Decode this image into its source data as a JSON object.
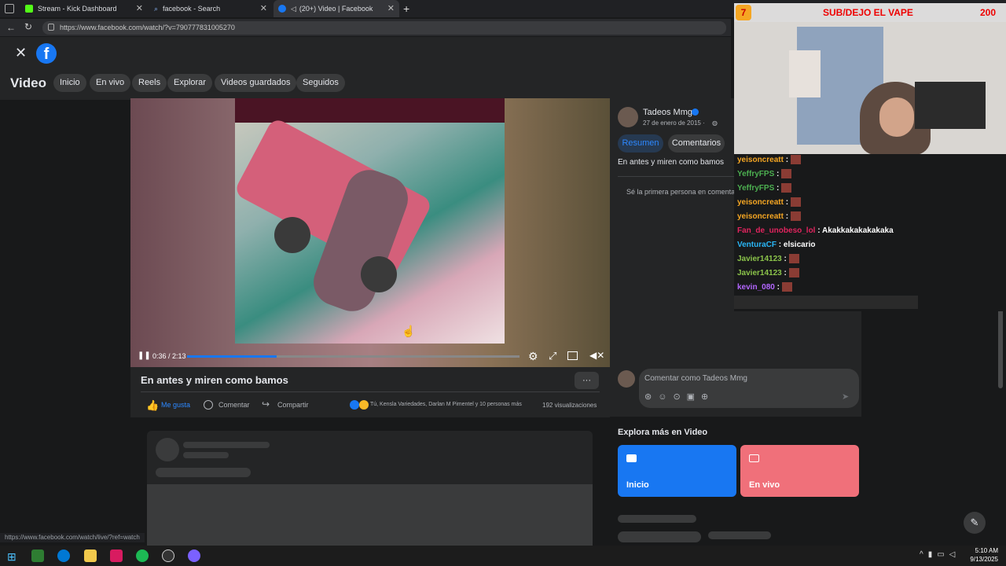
{
  "browser": {
    "tabs": [
      {
        "title": "Stream - Kick Dashboard",
        "active": false
      },
      {
        "title": "facebook - Search",
        "active": false
      },
      {
        "title": "(20+) Video | Facebook",
        "active": true
      }
    ],
    "new_tab": "+",
    "url": "https://www.facebook.com/watch/?v=790777831005270",
    "status_url": "https://www.facebook.com/watch/live/?ref=watch"
  },
  "fb": {
    "section_title": "Video",
    "nav": [
      "Inicio",
      "En vivo",
      "Reels",
      "Explorar",
      "Videos guardados",
      "Seguidos"
    ],
    "video": {
      "time": "0:36 / 2:13",
      "progress": 0.27,
      "title": "En antes y miren como bamos",
      "more": "···",
      "like": "Me gusta",
      "comment": "Comentar",
      "share": "Compartir",
      "reactions_text": "Tú, Kenslа Variedades, Darlan M Pimentel y 10 personas más",
      "views": "192 visualizaciones"
    },
    "post": {
      "author": "Tadeos Mmg",
      "date": "27 de enero de 2015 · ",
      "tabs": [
        "Resumen",
        "Comentarios"
      ],
      "caption": "En antes y miren como bamos",
      "first_comment": "Sé la primera persona en comentar",
      "comment_placeholder": "Comentar como Tadeos Mmg"
    },
    "explore": {
      "title": "Explora más en Video",
      "cards": [
        {
          "label": "Inicio",
          "color": "#1877f2"
        },
        {
          "label": "En vivo",
          "color": "#f0707a"
        }
      ]
    }
  },
  "overlay": {
    "count_left": "7",
    "goal_text": "SUB/DEJO EL VAPE",
    "count_right": "200",
    "chat": [
      {
        "user": "yeisoncreatt",
        "msg": "",
        "color": "#f5a623"
      },
      {
        "user": "YeffryFPS",
        "msg": "",
        "color": "#4caf50"
      },
      {
        "user": "YeffryFPS",
        "msg": "",
        "color": "#4caf50"
      },
      {
        "user": "yeisoncreatt",
        "msg": "",
        "color": "#f5a623"
      },
      {
        "user": "yeisoncreatt",
        "msg": "",
        "color": "#f5a623"
      },
      {
        "user": "Fan_de_unobeso_lol",
        "msg": "Akakkakakakakaka",
        "color": "#e0245e"
      },
      {
        "user": "VenturaCF",
        "msg": "elsicario",
        "color": "#29b6f6"
      },
      {
        "user": "Javier14123",
        "msg": "",
        "color": "#8bc34a"
      },
      {
        "user": "Javier14123",
        "msg": "",
        "color": "#8bc34a"
      },
      {
        "user": "kevin_080",
        "msg": "",
        "color": "#b366ff"
      }
    ]
  },
  "taskbar": {
    "time": "5:10 AM",
    "date": "9/13/2025"
  }
}
